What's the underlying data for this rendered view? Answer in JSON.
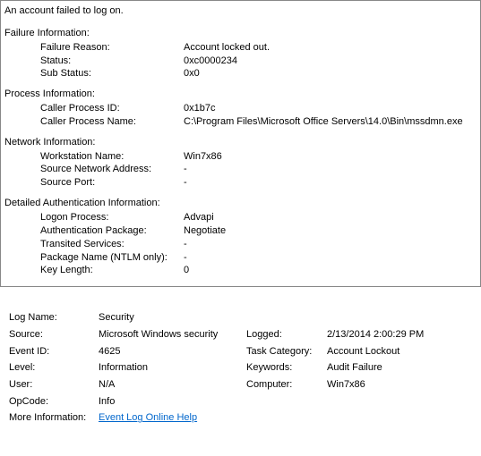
{
  "header": "An account failed to log on.",
  "failureInfo": {
    "title": "Failure Information:",
    "reasonLabel": "Failure Reason:",
    "reasonValue": "Account locked out.",
    "statusLabel": "Status:",
    "statusValue": "0xc0000234",
    "subStatusLabel": "Sub Status:",
    "subStatusValue": "0x0"
  },
  "processInfo": {
    "title": "Process Information:",
    "callerIdLabel": "Caller Process ID:",
    "callerIdValue": "0x1b7c",
    "callerNameLabel": "Caller Process Name:",
    "callerNameValue": "C:\\Program Files\\Microsoft Office Servers\\14.0\\Bin\\mssdmn.exe"
  },
  "networkInfo": {
    "title": "Network Information:",
    "workstationLabel": "Workstation Name:",
    "workstationValue": "Win7x86",
    "sourceAddrLabel": "Source Network Address:",
    "sourceAddrValue": "-",
    "sourcePortLabel": "Source Port:",
    "sourcePortValue": "-"
  },
  "authInfo": {
    "title": "Detailed Authentication Information:",
    "logonProcLabel": "Logon Process:",
    "logonProcValue": "Advapi",
    "authPkgLabel": "Authentication Package:",
    "authPkgValue": "Negotiate",
    "transitedLabel": "Transited Services:",
    "transitedValue": "-",
    "pkgNameLabel": "Package Name (NTLM only):",
    "pkgNameValue": "-",
    "keyLenLabel": "Key Length:",
    "keyLenValue": "0"
  },
  "summary": {
    "logNameLabel": "Log Name:",
    "logNameValue": "Security",
    "sourceLabel": "Source:",
    "sourceValue": "Microsoft Windows security",
    "loggedLabel": "Logged:",
    "loggedValue": "2/13/2014 2:00:29 PM",
    "eventIdLabel": "Event ID:",
    "eventIdValue": "4625",
    "taskCatLabel": "Task Category:",
    "taskCatValue": "Account Lockout",
    "levelLabel": "Level:",
    "levelValue": "Information",
    "keywordsLabel": "Keywords:",
    "keywordsValue": "Audit Failure",
    "userLabel": "User:",
    "userValue": "N/A",
    "computerLabel": "Computer:",
    "computerValue": "Win7x86",
    "opCodeLabel": "OpCode:",
    "opCodeValue": "Info",
    "moreInfoLabel": "More Information:",
    "moreInfoLink": "Event Log Online Help"
  }
}
